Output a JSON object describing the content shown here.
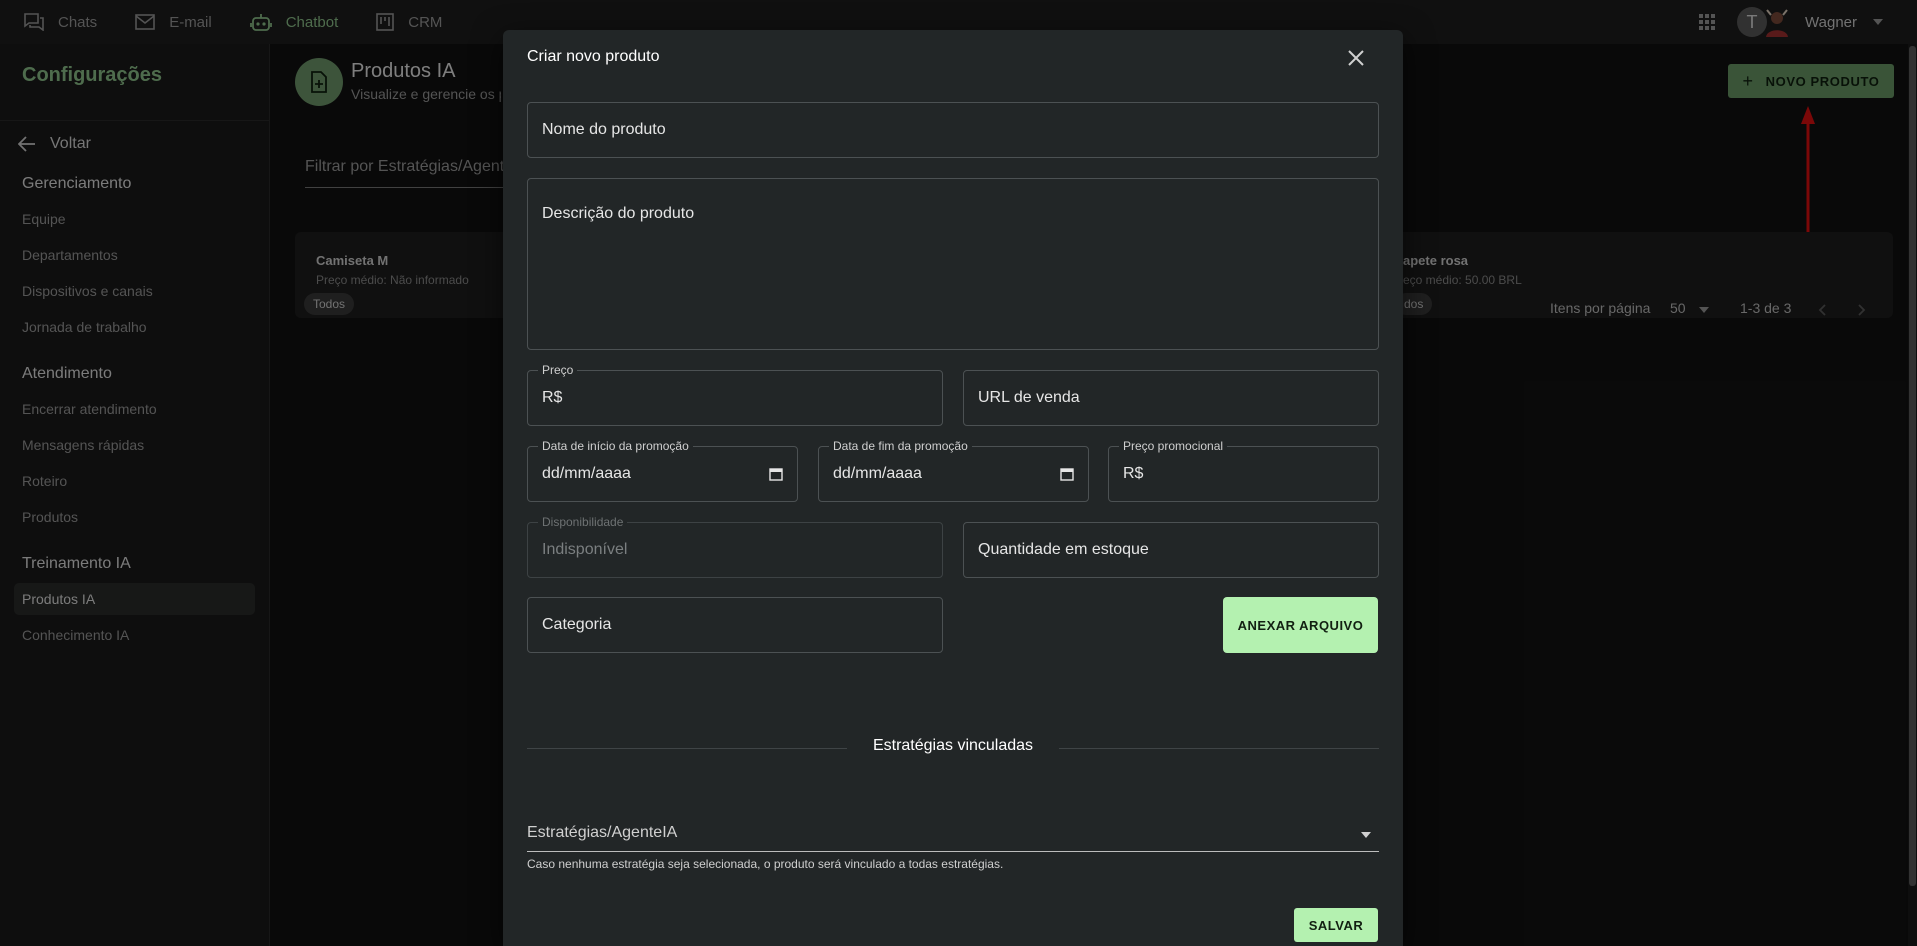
{
  "topbar": {
    "nav": [
      {
        "label": "Chats",
        "icon": "chat-icon"
      },
      {
        "label": "E-mail",
        "icon": "mail-icon"
      },
      {
        "label": "Chatbot",
        "icon": "robot-icon"
      },
      {
        "label": "CRM",
        "icon": "kanban-icon"
      }
    ],
    "avatar_initial": "T",
    "user_name": "Wagner"
  },
  "sidebar": {
    "title": "Configurações",
    "back_label": "Voltar",
    "sections": [
      {
        "title": "Gerenciamento",
        "items": [
          "Equipe",
          "Departamentos",
          "Dispositivos e canais",
          "Jornada de trabalho"
        ]
      },
      {
        "title": "Atendimento",
        "items": [
          "Encerrar atendimento",
          "Mensagens rápidas",
          "Roteiro",
          "Produtos"
        ]
      },
      {
        "title": "Treinamento IA",
        "items": [
          "Produtos IA",
          "Conhecimento IA"
        ]
      }
    ],
    "active_item": "Produtos IA"
  },
  "main": {
    "title": "Produtos IA",
    "subtitle": "Visualize e gerencie os p",
    "filter_placeholder": "Filtrar por Estratégias/Agente",
    "new_button": "NOVO PRODUTO",
    "cards": [
      {
        "title": "Camiseta M",
        "price": "Preço médio: Não informado",
        "chip": "Todos"
      },
      {
        "title": "apete rosa",
        "price": "eço médio: 50.00 BRL",
        "chip": "dos"
      }
    ],
    "pager": {
      "per_page_label": "Itens por página",
      "per_page_value": "50",
      "range": "1-3 de 3"
    }
  },
  "modal": {
    "title": "Criar novo produto",
    "fields": {
      "name": "Nome do produto",
      "description": "Descrição do produto",
      "price_label": "Preço",
      "price_prefix": "R$",
      "url": "URL de venda",
      "promo_start_label": "Data de início da promoção",
      "promo_start_value": "dd/mm/aaaa",
      "promo_end_label": "Data de fim da promoção",
      "promo_end_value": "dd/mm/aaaa",
      "promo_price_label": "Preço promocional",
      "promo_price_prefix": "R$",
      "availability_label": "Disponibilidade",
      "availability_value": "Indisponível",
      "stock": "Quantidade em estoque",
      "category": "Categoria"
    },
    "attach_button": "ANEXAR ARQUIVO",
    "section_title": "Estratégias vinculadas",
    "strategies_placeholder": "Estratégias/AgenteIA",
    "helper": "Caso nenhuma estratégia seja selecionada, o produto será vinculado a todas estratégias.",
    "save_button": "SALVAR"
  },
  "colors": {
    "accent": "#8fc58c",
    "button_green": "#b4f1b0",
    "modal_bg": "#222627",
    "annotation_arrow": "#e01010"
  }
}
